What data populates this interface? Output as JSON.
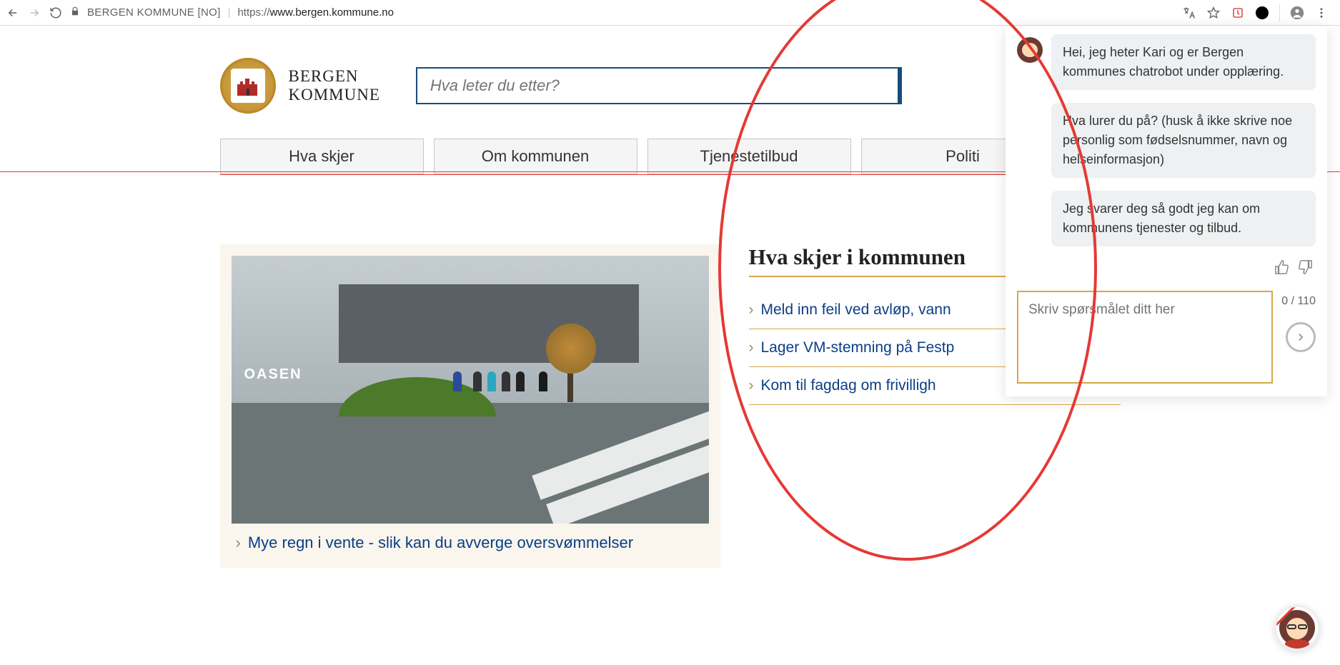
{
  "browser": {
    "site_label": "BERGEN KOMMUNE [NO]",
    "url_prefix": "https://",
    "url_host": "www.bergen.kommune.no"
  },
  "logo": {
    "line1": "BERGEN",
    "line2": "KOMMUNE"
  },
  "search": {
    "placeholder": "Hva leter du etter?"
  },
  "nav": {
    "items": [
      {
        "label": "Hva skjer"
      },
      {
        "label": "Om kommunen"
      },
      {
        "label": "Tjenestetilbud"
      },
      {
        "label": "Politi"
      }
    ]
  },
  "feature": {
    "oasen_label": "OASEN",
    "headline": "Mye regn i vente - slik kan du avverge oversvømmelser"
  },
  "news": {
    "heading": "Hva skjer i kommunen",
    "items": [
      {
        "label": "Meld inn feil ved avløp, vann"
      },
      {
        "label": "Lager VM-stemning på Festp"
      },
      {
        "label": "Kom til fagdag om frivilligh"
      }
    ]
  },
  "chat": {
    "messages": [
      {
        "with_avatar": true,
        "text": "Hei, jeg heter Kari og er Bergen kommunes chatrobot under opplæring."
      },
      {
        "with_avatar": false,
        "text": "Hva lurer du på? (husk å ikke skrive noe personlig som fødselsnummer, navn og helseinformasjon)"
      },
      {
        "with_avatar": false,
        "text": "Jeg svarer deg så godt jeg kan om kommunens tjenester og tilbud."
      }
    ],
    "input_placeholder": "Skriv spørsmålet ditt her",
    "counter": "0 / 110"
  }
}
